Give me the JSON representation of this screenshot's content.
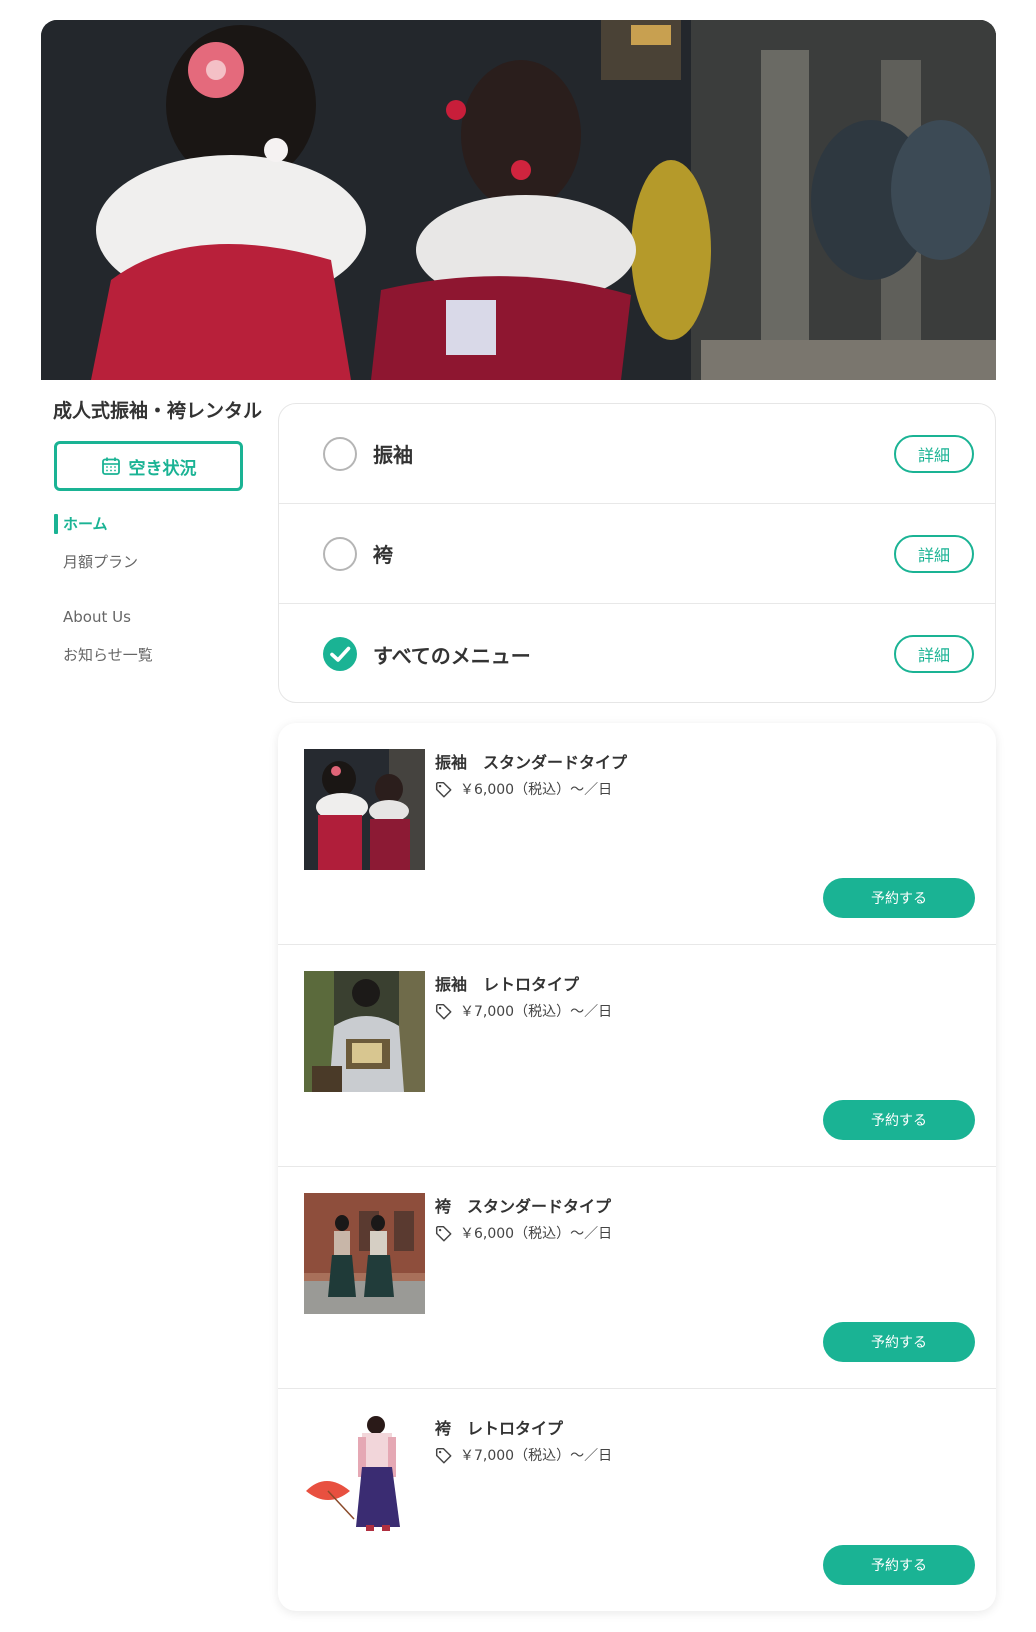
{
  "hero": {
    "image": "two women in furisode kimono with white fur stoles at a shrine"
  },
  "sidebar": {
    "shop_title": "成人式振袖・袴レンタル",
    "availability_button": "空き状況",
    "nav": [
      {
        "label": "ホーム",
        "active": true
      },
      {
        "label": "月額プラン",
        "active": false
      },
      {
        "label": "About Us",
        "active": false
      },
      {
        "label": "お知らせ一覧",
        "active": false
      }
    ]
  },
  "categories": [
    {
      "label": "振袖",
      "selected": false,
      "detail": "詳細"
    },
    {
      "label": "袴",
      "selected": false,
      "detail": "詳細"
    },
    {
      "label": "すべてのメニュー",
      "selected": true,
      "detail": "詳細"
    }
  ],
  "products": [
    {
      "name": "振袖　スタンダードタイプ",
      "price": "￥6,000（税込）〜／日",
      "button": "予約する",
      "thumb": "furisode-standard"
    },
    {
      "name": "振袖　レトロタイプ",
      "price": "￥7,000（税込）〜／日",
      "button": "予約する",
      "thumb": "furisode-retro"
    },
    {
      "name": "袴　スタンダードタイプ",
      "price": "￥6,000（税込）〜／日",
      "button": "予約する",
      "thumb": "hakama-standard"
    },
    {
      "name": "袴　レトロタイプ",
      "price": "￥7,000（税込）〜／日",
      "button": "予約する",
      "thumb": "hakama-retro"
    }
  ],
  "colors": {
    "accent": "#1ab394",
    "text": "#333333",
    "muted": "#666666"
  },
  "icons": {
    "calendar": "calendar-icon",
    "check": "check-icon",
    "price_tag": "tag-icon"
  }
}
